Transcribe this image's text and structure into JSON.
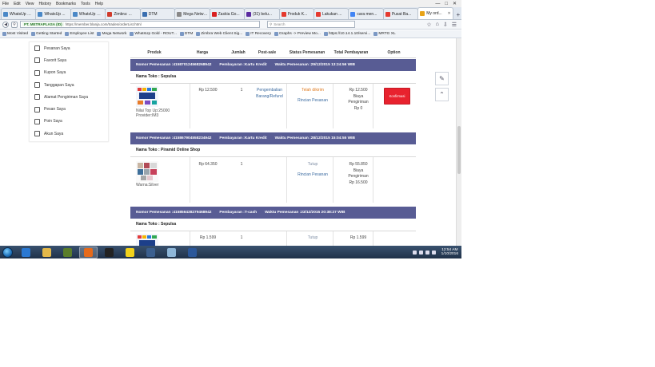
{
  "menubar": [
    "File",
    "Edit",
    "View",
    "History",
    "Bookmarks",
    "Tools",
    "Help"
  ],
  "tabs": [
    {
      "label": "WhatsUp Gold...",
      "color": "#4a88c7",
      "active": false
    },
    {
      "label": "WhatsUp ...",
      "color": "#4a88c7",
      "active": false
    },
    {
      "label": "WhatsUp Gol...",
      "color": "#4a88c7",
      "active": false
    },
    {
      "label": "Zimbra: ...",
      "color": "#d03b2b",
      "active": false
    },
    {
      "label": "DTM",
      "color": "#3a6fb0",
      "active": false
    },
    {
      "label": "Mega Network",
      "color": "#888888",
      "active": false
    },
    {
      "label": "Zaskia Go...",
      "color": "#d92020",
      "active": false
    },
    {
      "label": "(31) belu...",
      "color": "#5b2ca0",
      "active": false
    },
    {
      "label": "Produk K...",
      "color": "#e53a2f",
      "active": false
    },
    {
      "label": "Lakukan ...",
      "color": "#e53a2f",
      "active": false
    },
    {
      "label": "cara men...",
      "color": "#4285f4",
      "active": false
    },
    {
      "label": "Pusat Ba...",
      "color": "#e53a2f",
      "active": false
    },
    {
      "label": "My ord...",
      "color": "#e8a317",
      "active": true
    }
  ],
  "nav": {
    "site_identity": "PT. METRAPLASA (ID)",
    "url": "https://member.blanja.com/trades/orderList.html",
    "search_placeholder": "Search"
  },
  "bookmarks": [
    "Most Visited",
    "Getting Started",
    "Employee List",
    "Mega Network",
    "WhatsUp Gold - ROUT...",
    "DTM",
    "Zimbra Web Client Sig...",
    "IT Recovery",
    "Graphs -> Preview Mo...",
    "https://10.14.1.10/servi...",
    "MRTG XL"
  ],
  "sidebar": {
    "items": [
      {
        "label": "Pesanan Saya",
        "icon": "document-icon"
      },
      {
        "label": "Favorit Saya",
        "icon": "star-icon"
      },
      {
        "label": "Kupon Saya",
        "icon": "coupon-icon"
      },
      {
        "label": "Tanggapan Saya",
        "icon": "chat-icon"
      },
      {
        "label": "Alamat Pengiriman Saya",
        "icon": "truck-icon"
      },
      {
        "label": "Pesan Saya",
        "icon": "message-icon"
      },
      {
        "label": "Poin Saya",
        "icon": "points-icon"
      },
      {
        "label": "Akun Saya",
        "icon": "user-icon"
      }
    ]
  },
  "table": {
    "headers": {
      "produk": "Produk",
      "harga": "Harga",
      "jumlah": "Jumlah",
      "postsale": "Post-sale",
      "status": "Status Pemesanan",
      "total": "Total Pembayaran",
      "option": "Option"
    }
  },
  "orders": [
    {
      "bar": {
        "nomor": "Nomor Pemesanan :415870124568268942",
        "pembayaran": "Pembayaran :Kartu Kredit",
        "waktu": "Waktu Pemesanan :29/12/2015 13:24:56 WIB"
      },
      "toko": "Nama Toko  : Sepulsa",
      "product_lines": [
        "Nilai Top Up:25000",
        "Provider:IM3"
      ],
      "harga": "Rp 12.500",
      "jumlah": "1",
      "postsale": "Pengembalian Barang/Refund",
      "status": "Telah dikirim",
      "status_link": "Rincian Pesanan",
      "total_lines": [
        "Rp 12.500",
        "Biaya",
        "Pengiriman",
        "Rp 0"
      ],
      "option_button": "Konfirmasi"
    },
    {
      "bar": {
        "nomor": "Nomor Pemesanan :415867904558234942",
        "pembayaran": "Pembayaran :Kartu Kredit",
        "waktu": "Waktu Pemesanan :28/12/2015 15:04:55 WIB"
      },
      "toko": "Nama Toko  : Piramid Online Shop",
      "product_lines": [
        "Warna:Silver"
      ],
      "harga": "Rp 64.350",
      "jumlah": "1",
      "postsale": "",
      "status": "Tutup",
      "status_link": "Rincian Pesanan",
      "total_lines": [
        "Rp 55.850",
        "Biaya",
        "Pengiriman",
        "Rp 16.500"
      ],
      "option_button": ""
    },
    {
      "bar": {
        "nomor": "Nomor Pemesanan :415856438279468942",
        "pembayaran": "Pembayaran :T-cash",
        "waktu": "Waktu Pemesanan :23/12/2015 20:38:27 WIB"
      },
      "toko": "Nama Toko  : Sepulsa",
      "product_lines": [],
      "harga": "Rp 1.599",
      "jumlah": "1",
      "postsale": "",
      "status": "Tutup",
      "status_link": "",
      "total_lines": [
        "Rp 1.599"
      ],
      "option_button": ""
    }
  ],
  "taskbar": {
    "apps": [
      "ie-icon",
      "explorer-icon",
      "media-player-icon",
      "firefox-icon",
      "terminal-icon",
      "app-yellow-icon",
      "app-chart-icon",
      "pen-tool-icon",
      "word-icon"
    ],
    "active_index": 3,
    "time": "12:54 AM",
    "date": "1/10/2016"
  }
}
